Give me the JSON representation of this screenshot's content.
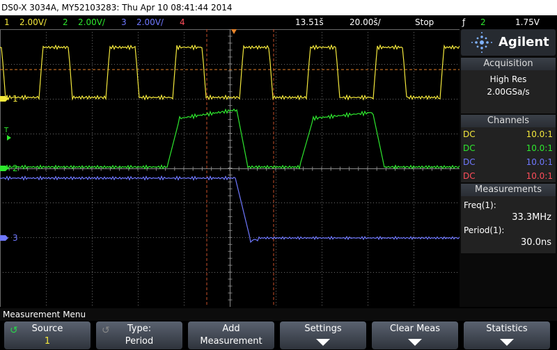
{
  "title": "DS0-X 3034A, MY52103283: Thu Apr 10 08:41:44 2014",
  "status": {
    "ch1": "1",
    "ch1_scale": "2.00V/",
    "ch2": "2",
    "ch2_scale": "2.00V/",
    "ch3": "3",
    "ch3_scale": "2.00V/",
    "ch4": "4",
    "time_pos": "13.51š",
    "time_scale": "20.00š/",
    "run_state": "Stop",
    "trig_symbol": "ƒ",
    "trig_ch": "2",
    "trig_level": "1.75V"
  },
  "markers": {
    "ch1": "1",
    "ch2": "2",
    "ch3": "3",
    "trigger": "T"
  },
  "brand": "Agilent",
  "acquisition": {
    "header": "Acquisition",
    "mode": "High Res",
    "rate": "2.00GSa/s"
  },
  "channels": {
    "header": "Channels",
    "rows": [
      {
        "coupling": "DC",
        "probe": "10.0:1",
        "color": "#f4e83c"
      },
      {
        "coupling": "DC",
        "probe": "10.0:1",
        "color": "#2ee82e"
      },
      {
        "coupling": "DC",
        "probe": "10.0:1",
        "color": "#6f78ff"
      },
      {
        "coupling": "DC",
        "probe": "10.0:1",
        "color": "#ff4d5a"
      }
    ]
  },
  "measurements": {
    "header": "Measurements",
    "items": [
      {
        "label": "Freq(1):",
        "value": "33.3MHz"
      },
      {
        "label": "Period(1):",
        "value": "30.0ns"
      }
    ]
  },
  "menu_title": "Measurement Menu",
  "softkeys": [
    {
      "line1": "Source",
      "line2": "1"
    },
    {
      "line1": "Type:",
      "line2": "Period"
    },
    {
      "line1": "Add",
      "line2": "Measurement"
    },
    {
      "line1": "Settings",
      "line2": ""
    },
    {
      "line1": "Clear Meas",
      "line2": ""
    },
    {
      "line1": "Statistics",
      "line2": ""
    }
  ],
  "colors": {
    "ch1": "#f4e83c",
    "ch2": "#2ee82e",
    "ch3": "#6f78ff",
    "ch4": "#ff4d5a",
    "trigger_level": "#e8842a",
    "cursor": "#c8502a"
  }
}
